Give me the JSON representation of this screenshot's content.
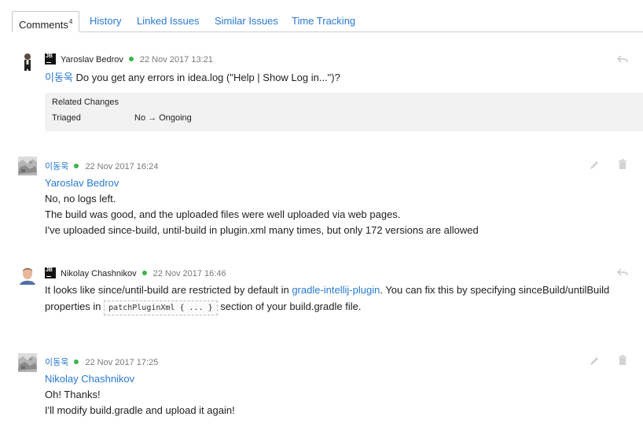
{
  "tabs": [
    {
      "label": "Comments",
      "count": "4",
      "active": true
    },
    {
      "label": "History"
    },
    {
      "label": "Linked Issues"
    },
    {
      "label": "Similar Issues"
    },
    {
      "label": "Time Tracking"
    }
  ],
  "comments": [
    {
      "author": "Yaroslav Bedrov",
      "badge": "JB",
      "date": "22 Nov 2017 13:21",
      "mention": "이동욱",
      "lines": [
        "Do you get any errors in idea.log (\"Help | Show Log in...\")?"
      ],
      "related": {
        "heading": "Related Changes",
        "field": "Triaged",
        "from": "No",
        "arrow": "→",
        "to": "Ongoing"
      }
    },
    {
      "author": "이동욱",
      "date": "22 Nov 2017 16:24",
      "mention": "Yaroslav Bedrov",
      "lines": [
        "No, no logs left.",
        "The build was good, and the uploaded files were well uploaded via web pages.",
        "I've uploaded since-build, until-build in plugin.xml many times, but only 172 versions are allowed"
      ]
    },
    {
      "author": "Nikolay Chashnikov",
      "badge": "JB",
      "date": "22 Nov 2017 16:46",
      "line1_pre": "It looks like since/until-build are restricted by default in ",
      "line1_link": "gradle-intellij-plugin",
      "line1_post": ". You can fix this by specifying sinceBuild/untilBuild",
      "line2_pre": "properties in ",
      "line2_code": "patchPluginXml { ... }",
      "line2_post": " section of your build.gradle file."
    },
    {
      "author": "이동욱",
      "date": "22 Nov 2017 17:25",
      "mention": "Nikolay Chashnikov",
      "lines": [
        "Oh! Thanks!",
        "I'll modify build.gradle and upload it again!"
      ]
    }
  ],
  "icons": {
    "reply": "reply-arrow-icon",
    "edit": "pencil-icon",
    "delete": "trash-icon"
  },
  "colors": {
    "link": "#2a7ad0",
    "online": "#3bb54a",
    "meta_gray": "#7a7a7a",
    "related_bg": "#f2f2f2"
  }
}
